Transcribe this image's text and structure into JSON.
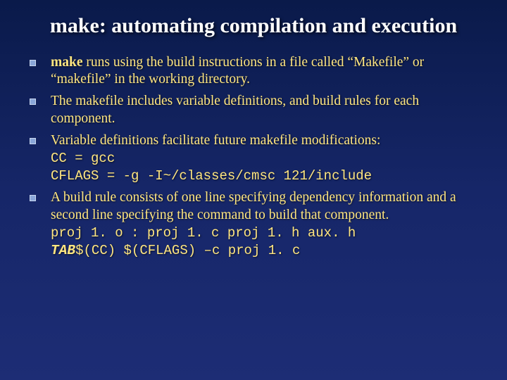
{
  "title": "make: automating compilation and execution",
  "items": [
    {
      "lead_bold": "make",
      "rest": " runs using the build instructions in a file called “Makefile” or “makefile” in the working directory."
    },
    {
      "text": "The makefile includes variable definitions, and build rules for each component."
    },
    {
      "text": "Variable definitions facilitate future makefile modifications:",
      "code1": "CC = gcc",
      "code2": "CFLAGS = -g -I~/classes/cmsc 121/include"
    },
    {
      "text": "A build rule consists of one line specifying dependency information and a second line specifying the command to build that component.",
      "code1": "proj 1. o : proj 1. c proj 1. h aux. h",
      "tab_label": "TAB",
      "code2": "$(CC) $(CFLAGS) –c proj 1. c"
    }
  ]
}
